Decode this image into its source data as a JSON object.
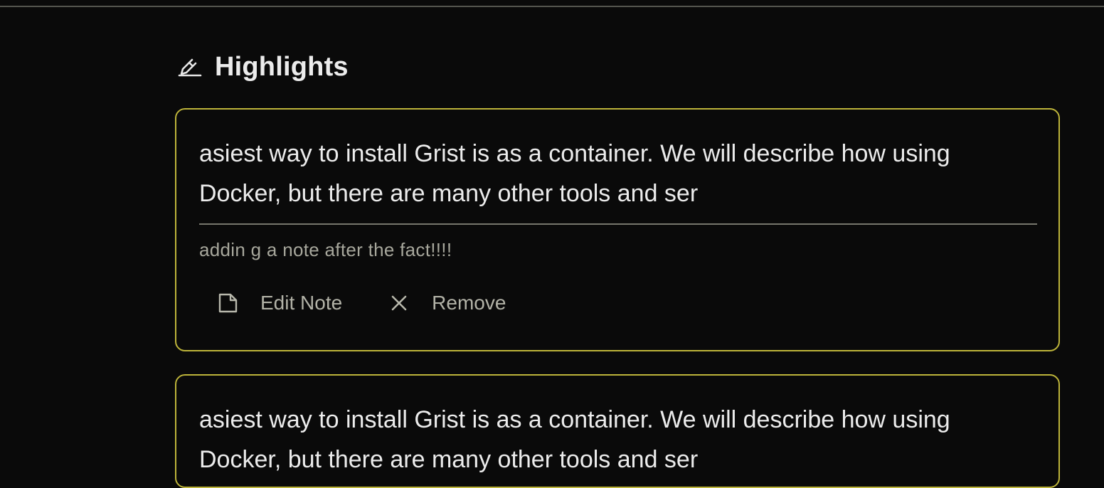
{
  "header": {
    "icon": "highlighter-icon",
    "title": "Highlights"
  },
  "highlights": [
    {
      "text": "asiest way to install Grist is as a container. We will describe how using Docker, but there are many other tools and ser",
      "note": "addin g a note after the fact!!!!",
      "actions": {
        "edit_icon": "note-icon",
        "edit_label": "Edit Note",
        "remove_icon": "close-icon",
        "remove_label": "Remove"
      }
    },
    {
      "text": "asiest way to install Grist is as a container. We will describe how using Docker, but there are many other tools and ser"
    }
  ],
  "colors": {
    "background": "#0a0a0a",
    "card_border": "#bdb43a",
    "text": "#ececec",
    "muted": "#a7a79c"
  }
}
